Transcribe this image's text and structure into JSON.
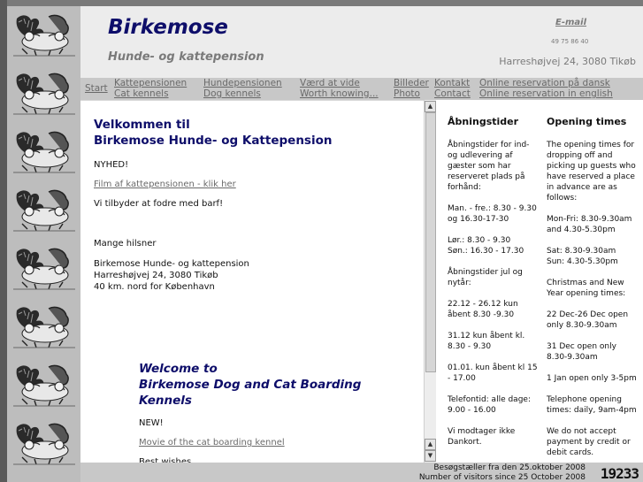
{
  "header": {
    "title": "Birkemose",
    "subtitle": "Hunde- og kattepension",
    "email_label": "E-mail",
    "phone": "49 75 86 40",
    "address": "Harreshøjvej 24, 3080 Tikøb"
  },
  "nav": {
    "start": "Start",
    "items": [
      {
        "da": "Kattepensionen",
        "en": "Cat kennels"
      },
      {
        "da": "Hundepensionen",
        "en": "Dog kennels"
      },
      {
        "da": "Værd at vide",
        "en": "Worth knowing..."
      },
      {
        "da": "Billeder",
        "en": "Photo"
      },
      {
        "da": "Kontakt",
        "en": "Contact"
      },
      {
        "da": "Online reservation på dansk",
        "en": "Online reservation in english"
      }
    ]
  },
  "main": {
    "welcome_da_line1": "Velkommen til",
    "welcome_da_line2": "Birkemose Hunde- og Kattepension",
    "news_da": "NYHED!",
    "film_link_da": "Film af kattepensionen - klik her",
    "offer_da": "Vi tilbyder at fodre med barf!",
    "greeting_da": "Mange hilsner",
    "sign_name": "Birkemose Hunde- og kattepension",
    "sign_address": "Harreshøjvej 24, 3080 Tikøb",
    "sign_distance": "40 km. nord for København",
    "welcome_en_line1": "Welcome to",
    "welcome_en_line2": "Birkemose Dog and Cat Boarding",
    "welcome_en_line3": "Kennels",
    "news_en": "NEW!",
    "film_link_en": "Movie of the cat boarding kennel",
    "greeting_en": "Best wishes"
  },
  "hours_da": {
    "heading": "Åbningstider",
    "lines": [
      "Åbningstider for ind-",
      "og udlevering af",
      "gæster som har",
      "reserveret plads på",
      "forhånd:",
      "",
      "Man. - fre.: 8.30 - 9.30",
      "og 16.30-17-30",
      "",
      "Lør.: 8.30 - 9.30",
      "Søn.: 16.30 - 17.30",
      "",
      "Åbningstider jul og",
      "nytår:",
      "",
      "22.12 - 26.12 kun",
      "åbent 8.30 -9.30",
      "",
      "31.12 kun åbent kl.",
      "8.30 - 9.30",
      "",
      "01.01. kun åbent kl 15",
      "- 17.00",
      "",
      "Telefontid: alle dage:",
      "9.00 - 16.00",
      "",
      "Vi modtager ikke",
      "Dankort."
    ]
  },
  "hours_en": {
    "heading": "Opening times",
    "lines": [
      "The opening times for",
      "dropping off and",
      "picking up guests who",
      "have reserved a place",
      "in advance are as",
      "follows:",
      "",
      "Mon-Fri: 8.30-9.30am",
      "and 4.30-5.30pm",
      "",
      "Sat: 8.30-9.30am",
      "Sun: 4.30-5.30pm",
      "",
      "Christmas and New",
      "Year opening times:",
      "",
      "22 Dec-26 Dec open",
      "only 8.30-9.30am",
      "",
      "31 Dec open only",
      "8.30-9.30am",
      "",
      "1 Jan open only 3-5pm",
      "",
      "Telephone opening",
      "times: daily, 9am-4pm",
      "",
      "We do not accept",
      "payment by credit or",
      "debit cards."
    ]
  },
  "footer": {
    "counter_da": "Besøgstæller fra den 25.oktober 2008",
    "counter_en": "Number of visitors since 25 October 2008",
    "count": "19233"
  },
  "icons": {
    "scroll_up": "scroll-up-arrow",
    "scroll_down": "scroll-down-arrow",
    "dog_images": "dog-illustration"
  },
  "colors": {
    "brand_navy": "#0e0e6a",
    "header_bg": "#ececec",
    "nav_bg": "#c8c8c8",
    "link_grey": "#6a6a6a"
  }
}
